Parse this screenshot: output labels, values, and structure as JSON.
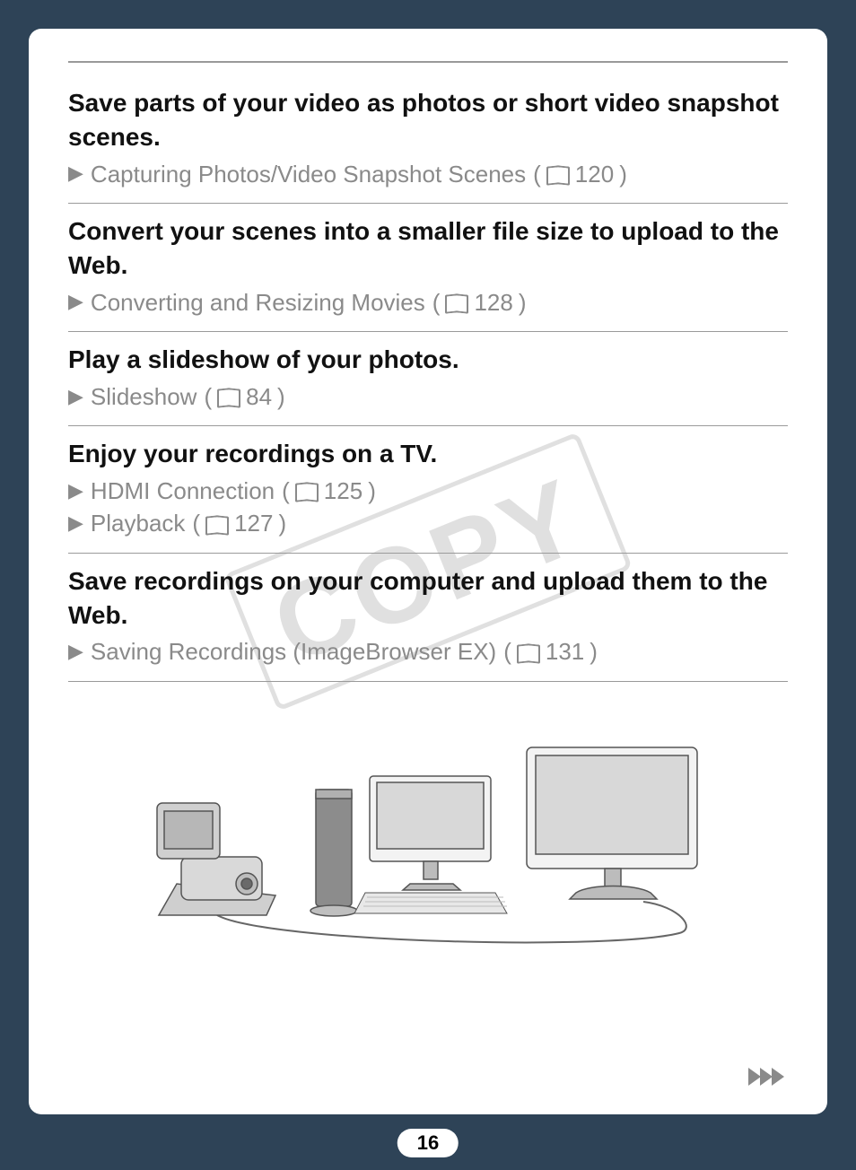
{
  "watermark": "COPY",
  "pageNumber": "16",
  "sections": [
    {
      "title": "Save parts of your video as photos or short video snapshot scenes.",
      "refs": [
        {
          "label": "Capturing Photos/Video Snapshot Scenes",
          "page": "120"
        }
      ]
    },
    {
      "title": "Convert your scenes into a smaller file size to upload to the Web.",
      "refs": [
        {
          "label": "Converting and Resizing Movies",
          "page": "128"
        }
      ]
    },
    {
      "title": "Play a slideshow of your photos.",
      "refs": [
        {
          "label": "Slideshow",
          "page": "84"
        }
      ]
    },
    {
      "title": "Enjoy your recordings on a TV.",
      "refs": [
        {
          "label": "HDMI Connection",
          "page": "125"
        },
        {
          "label": "Playback",
          "page": "127"
        }
      ]
    },
    {
      "title": "Save recordings on your computer and upload them to the Web.",
      "refs": [
        {
          "label": "Saving Recordings (ImageBrowser EX)",
          "page": "131"
        }
      ]
    }
  ]
}
